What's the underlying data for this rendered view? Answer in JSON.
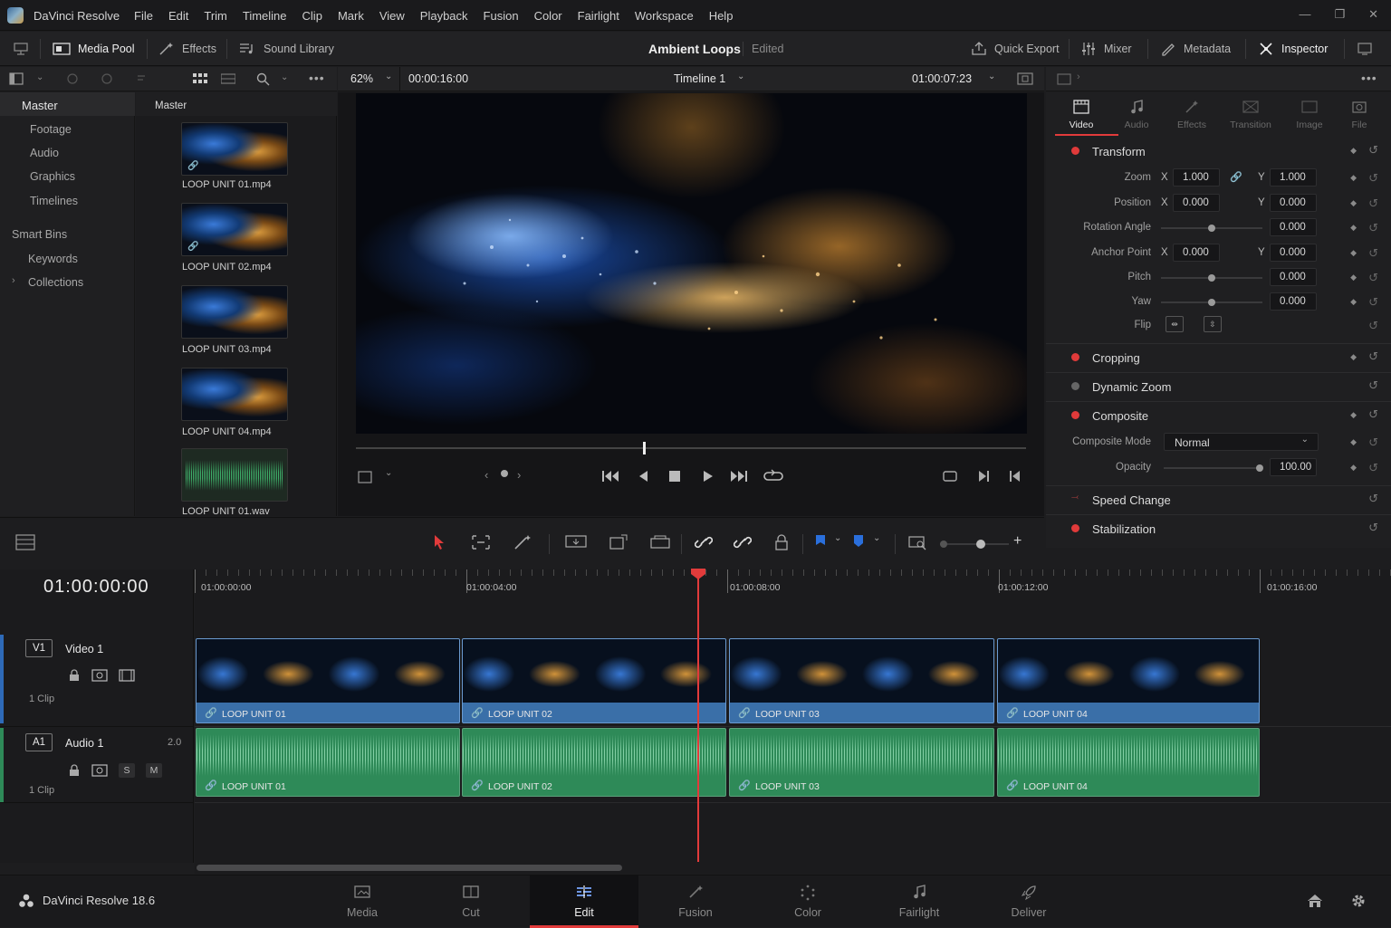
{
  "app": {
    "title": "DaVinci Resolve",
    "version_label": "DaVinci Resolve 18.6"
  },
  "menus": [
    "File",
    "Edit",
    "Trim",
    "Timeline",
    "Clip",
    "Mark",
    "View",
    "Playback",
    "Fusion",
    "Color",
    "Fairlight",
    "Workspace",
    "Help"
  ],
  "toolbar": {
    "media_pool": "Media Pool",
    "effects": "Effects",
    "sound_library": "Sound Library",
    "project_title": "Ambient Loops",
    "project_status": "Edited",
    "quick_export": "Quick Export",
    "mixer": "Mixer",
    "metadata": "Metadata",
    "inspector": "Inspector"
  },
  "viewer": {
    "zoom": "62%",
    "source_tc": "00:00:16:00",
    "timeline_name": "Timeline 1",
    "record_tc": "01:00:07:23"
  },
  "bins": {
    "master": "Master",
    "items": [
      "Footage",
      "Audio",
      "Graphics",
      "Timelines"
    ],
    "smart_bins": "Smart Bins",
    "smart_items": [
      "Keywords",
      "Collections"
    ]
  },
  "clips": {
    "header": "Master",
    "items": [
      "LOOP UNIT 01.mp4",
      "LOOP UNIT 02.mp4",
      "LOOP UNIT 03.mp4",
      "LOOP UNIT 04.mp4",
      "LOOP UNIT 01.wav"
    ]
  },
  "inspector": {
    "tabs": [
      "Video",
      "Audio",
      "Effects",
      "Transition",
      "Image",
      "File"
    ],
    "transform": "Transform",
    "zoom_label": "Zoom",
    "zoom_x": "1.000",
    "zoom_y": "1.000",
    "position_label": "Position",
    "position_x": "0.000",
    "position_y": "0.000",
    "rotation_label": "Rotation Angle",
    "rotation": "0.000",
    "anchor_label": "Anchor Point",
    "anchor_x": "0.000",
    "anchor_y": "0.000",
    "pitch_label": "Pitch",
    "pitch": "0.000",
    "yaw_label": "Yaw",
    "yaw": "0.000",
    "flip_label": "Flip",
    "axis_x": "X",
    "axis_y": "Y",
    "cropping": "Cropping",
    "dynamic_zoom": "Dynamic Zoom",
    "composite": "Composite",
    "composite_mode_label": "Composite Mode",
    "composite_mode": "Normal",
    "opacity_label": "Opacity",
    "opacity": "100.00",
    "speed_change": "Speed Change",
    "stabilization": "Stabilization"
  },
  "timeline": {
    "timecode": "01:00:00:00",
    "ruler": [
      "01:00:00:00",
      "01:00:04:00",
      "01:00:08:00",
      "01:00:12:00",
      "01:00:16:00"
    ],
    "v1": {
      "id": "V1",
      "name": "Video 1",
      "clips_count": "1 Clip"
    },
    "a1": {
      "id": "A1",
      "name": "Audio 1",
      "channel": "2.0",
      "clips_count": "1 Clip",
      "solo": "S",
      "mute": "M"
    },
    "video_clips": [
      "LOOP UNIT 01",
      "LOOP UNIT 02",
      "LOOP UNIT 03",
      "LOOP UNIT 04"
    ],
    "audio_clips": [
      "LOOP UNIT 01",
      "LOOP UNIT 02",
      "LOOP UNIT 03",
      "LOOP UNIT 04"
    ]
  },
  "pages": [
    "Media",
    "Cut",
    "Edit",
    "Fusion",
    "Color",
    "Fairlight",
    "Deliver"
  ],
  "colors": {
    "accent": "#e23b3b",
    "video_clip": "#3a6fa8",
    "audio_clip": "#2e8a58"
  }
}
